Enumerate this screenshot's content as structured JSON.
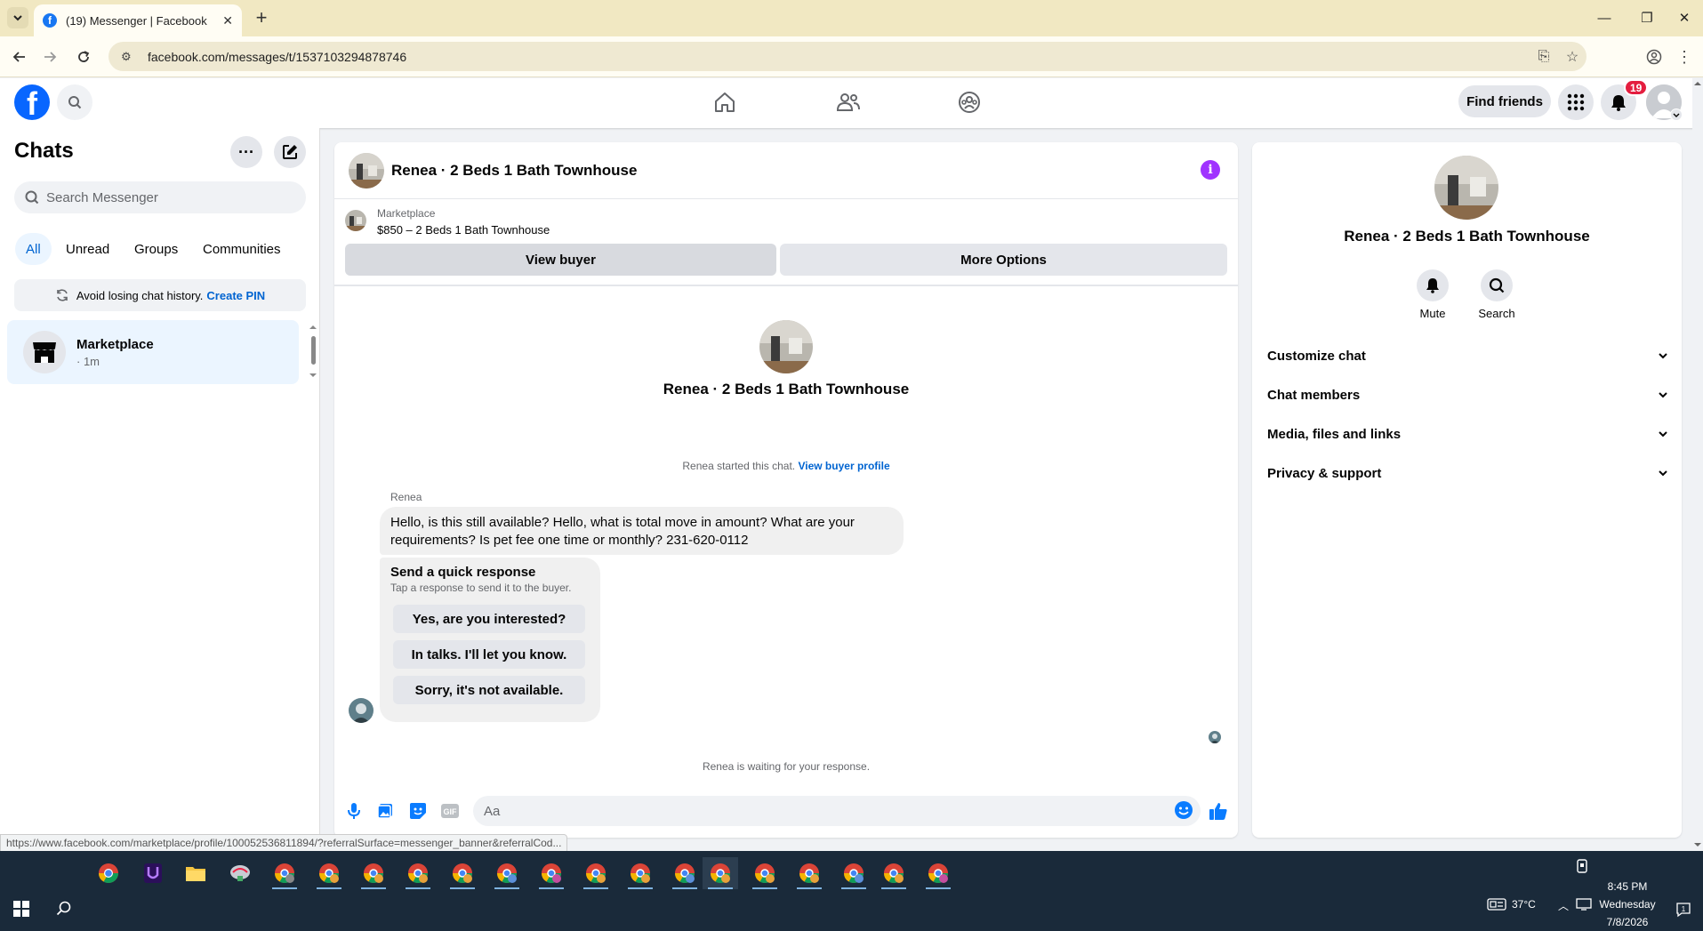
{
  "browser": {
    "tab_title": "(19) Messenger | Facebook",
    "url": "facebook.com/messages/t/1537103294878746",
    "status_link": "https://www.facebook.com/marketplace/profile/100052536811894/?referralSurface=messenger_banner&referralCod..."
  },
  "fb_nav": {
    "find_friends": "Find friends",
    "notification_count": "19"
  },
  "sidebar": {
    "title": "Chats",
    "search_placeholder": "Search Messenger",
    "filters": [
      "All",
      "Unread",
      "Groups",
      "Communities"
    ],
    "pin_banner_text": "Avoid losing chat history.",
    "pin_banner_link": "Create PIN",
    "chats": [
      {
        "name": "Marketplace",
        "time": "· 1m"
      }
    ]
  },
  "conversation": {
    "title": "Renea · 2 Beds 1 Bath Townhouse",
    "marketplace_label": "Marketplace",
    "listing": "$850 – 2 Beds 1 Bath Townhouse",
    "view_buyer": "View buyer",
    "more_options": "More Options",
    "profile_name": "Renea · 2 Beds 1 Bath Townhouse",
    "started_text": "Renea started this chat.",
    "started_link": "View buyer profile",
    "sender": "Renea",
    "message_line1": "Hello, is this still available? Hello, what is total move in amount? What are your",
    "message_line2": "requirements? Is pet fee one time or monthly? 231-620-0112",
    "quick_title": "Send a quick response",
    "quick_subtitle": "Tap a response to send it to the buyer.",
    "quick_responses": [
      "Yes, are you interested?",
      "In talks. I'll let you know.",
      "Sorry, it's not available."
    ],
    "waiting_text": "Renea is waiting for your response.",
    "composer_placeholder": "Aa"
  },
  "right_panel": {
    "name": "Renea · 2 Beds 1 Bath Townhouse",
    "actions": [
      "Mute",
      "Search"
    ],
    "sections": [
      "Customize chat",
      "Chat members",
      "Media, files and links",
      "Privacy & support"
    ]
  },
  "taskbar": {
    "time": "8:45 PM",
    "day": "Wednesday",
    "date": "7/8/2026",
    "temperature": "37°C"
  },
  "colors": {
    "fb_blue": "#0866ff",
    "link_blue": "#0064d1",
    "badge_red": "#e41e3f",
    "info_purple": "#a033ff",
    "messenger_blue": "#0a7cff"
  }
}
